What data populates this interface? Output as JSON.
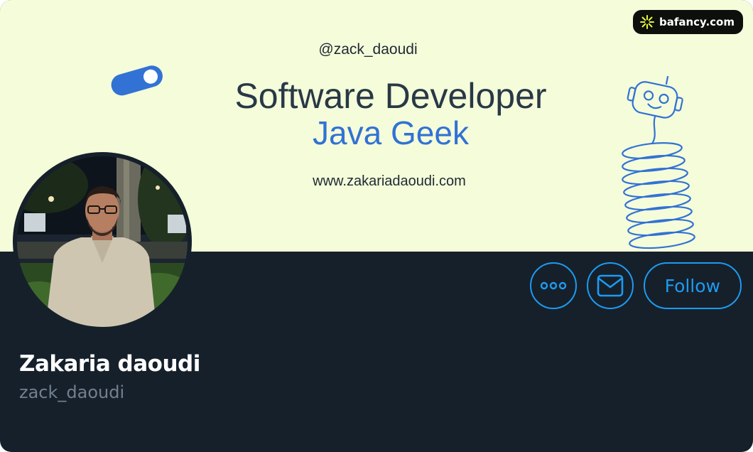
{
  "brand": {
    "badge_text": "bafancy.com",
    "badge_icon": "sparkle-icon"
  },
  "banner": {
    "handle": "@zack_daoudi",
    "title_line1": "Software Developer",
    "title_line2": "Java Geek",
    "website": "www.zakariadaoudi.com",
    "colors": {
      "background": "#f4fcda",
      "title": "#283845",
      "accent": "#3272d4"
    }
  },
  "profile": {
    "display_name": "Zakaria daoudi",
    "username": "zack_daoudi"
  },
  "actions": {
    "more_icon": "more-icon",
    "message_icon": "mail-icon",
    "follow_label": "Follow",
    "accent": "#1d9bf0"
  }
}
